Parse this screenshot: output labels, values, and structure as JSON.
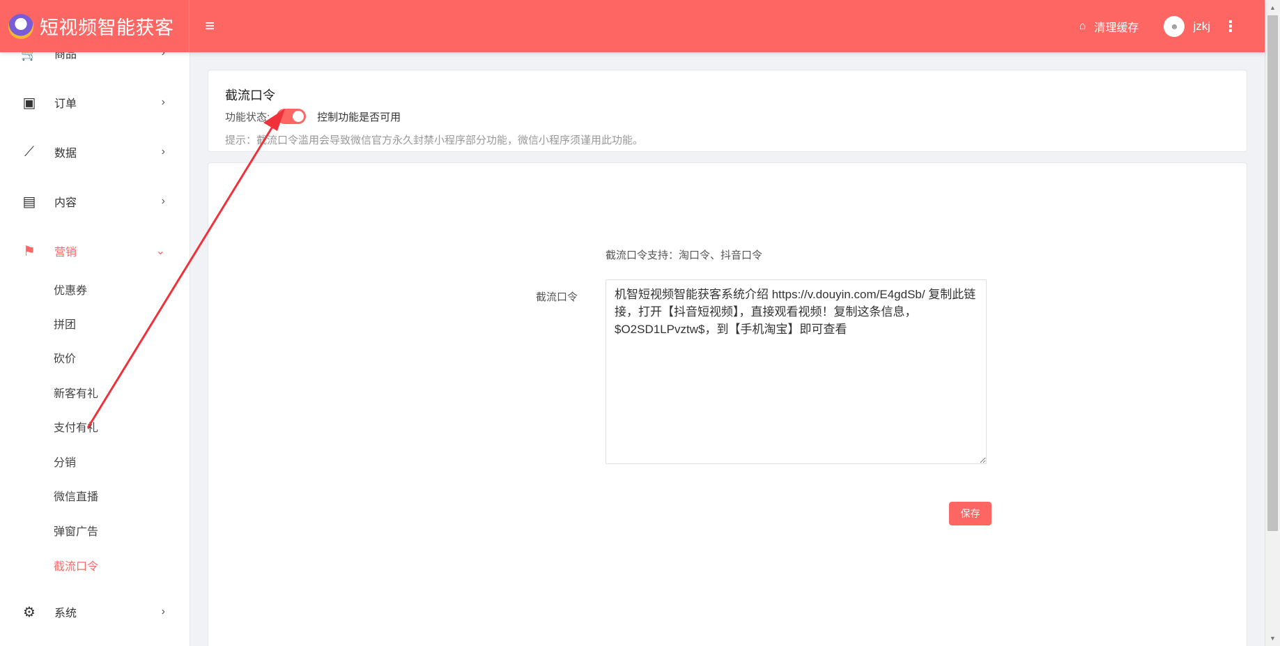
{
  "header": {
    "brand_name": "短视频智能获客",
    "menu_icon": "hamburger-icon",
    "clear_cache_label": "清理缓存",
    "username": "jzkj"
  },
  "sidebar": {
    "items": [
      {
        "label": "商品",
        "icon": "cart-icon"
      },
      {
        "label": "订单",
        "icon": "money-icon"
      },
      {
        "label": "数据",
        "icon": "chart-line-icon"
      },
      {
        "label": "内容",
        "icon": "document-icon"
      },
      {
        "label": "营销",
        "icon": "flag-icon",
        "active": true
      },
      {
        "label": "系统",
        "icon": "gear-icon"
      }
    ],
    "marketing_sub": [
      "优惠券",
      "拼团",
      "砍价",
      "新客有礼",
      "支付有礼",
      "分销",
      "微信直播",
      "弹窗广告",
      "截流口令"
    ]
  },
  "panel": {
    "title": "截流口令",
    "status_label": "功能状态:",
    "status_on": true,
    "status_desc": "控制功能是否可用",
    "hint": "提示：截流口令滥用会导致微信官方永久封禁小程序部分功能，微信小程序须谨用此功能。"
  },
  "form": {
    "support_text": "截流口令支持：淘口令、抖音口令",
    "field_label": "截流口令",
    "field_value": "机智短视频智能获客系统介绍 https://v.douyin.com/E4gdSb/ 复制此链接，打开【抖音短视频】，直接观看视频！复制这条信息，$O2SD1LPvztw$，到【手机淘宝】即可查看",
    "save_label": "保存"
  },
  "colors": {
    "accent": "#fe6663",
    "background": "#f0f2f5"
  }
}
